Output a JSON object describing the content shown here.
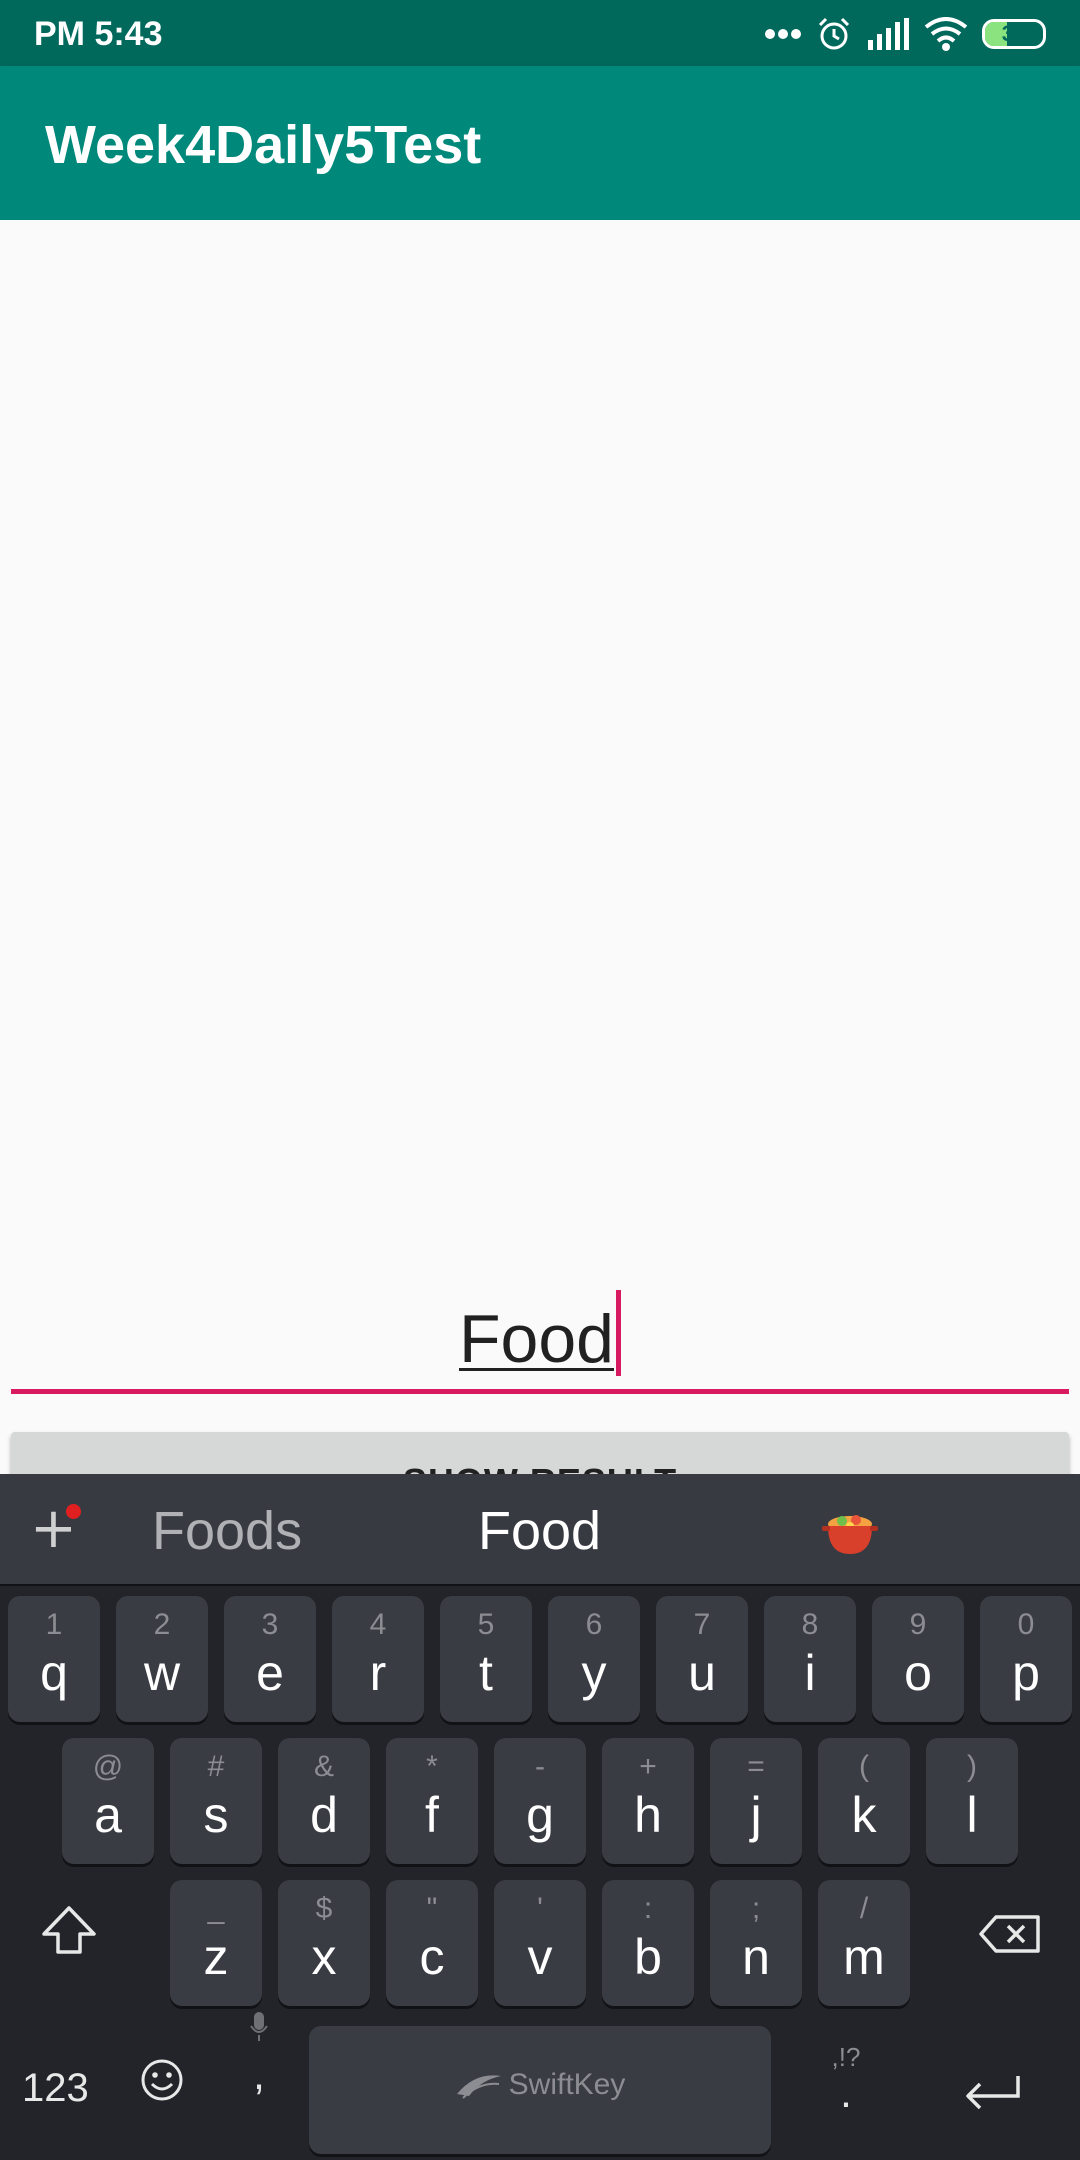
{
  "status_bar": {
    "time": "PM 5:43",
    "battery": "38",
    "battery_level_pct": 38,
    "icons": [
      "more-dots-icon",
      "alarm-icon",
      "signal-icon",
      "wifi-icon",
      "battery-icon"
    ]
  },
  "app_bar": {
    "title": "Week4Daily5Test"
  },
  "form": {
    "edit_text_value": "Food",
    "button_label": "SHOW RESULT",
    "accent_color": "#d81b60"
  },
  "keyboard": {
    "suggestions": [
      "Foods",
      "Food"
    ],
    "suggestion_emoji": "pot-of-food-emoji",
    "row1": [
      {
        "hint": "1",
        "key": "q"
      },
      {
        "hint": "2",
        "key": "w"
      },
      {
        "hint": "3",
        "key": "e"
      },
      {
        "hint": "4",
        "key": "r"
      },
      {
        "hint": "5",
        "key": "t"
      },
      {
        "hint": "6",
        "key": "y"
      },
      {
        "hint": "7",
        "key": "u"
      },
      {
        "hint": "8",
        "key": "i"
      },
      {
        "hint": "9",
        "key": "o"
      },
      {
        "hint": "0",
        "key": "p"
      }
    ],
    "row2": [
      {
        "hint": "@",
        "key": "a"
      },
      {
        "hint": "#",
        "key": "s"
      },
      {
        "hint": "&",
        "key": "d"
      },
      {
        "hint": "*",
        "key": "f"
      },
      {
        "hint": "-",
        "key": "g"
      },
      {
        "hint": "+",
        "key": "h"
      },
      {
        "hint": "=",
        "key": "j"
      },
      {
        "hint": "(",
        "key": "k"
      },
      {
        "hint": ")",
        "key": "l"
      }
    ],
    "row3": [
      {
        "hint": "_",
        "key": "z"
      },
      {
        "hint": "$",
        "key": "x"
      },
      {
        "hint": "\"",
        "key": "c"
      },
      {
        "hint": "'",
        "key": "v"
      },
      {
        "hint": ":",
        "key": "b"
      },
      {
        "hint": ";",
        "key": "n"
      },
      {
        "hint": "/",
        "key": "m"
      }
    ],
    "numbers_key": "123",
    "comma_key": ",",
    "period_key": ".",
    "period_hint": ",!?",
    "space_brand": "SwiftKey"
  }
}
